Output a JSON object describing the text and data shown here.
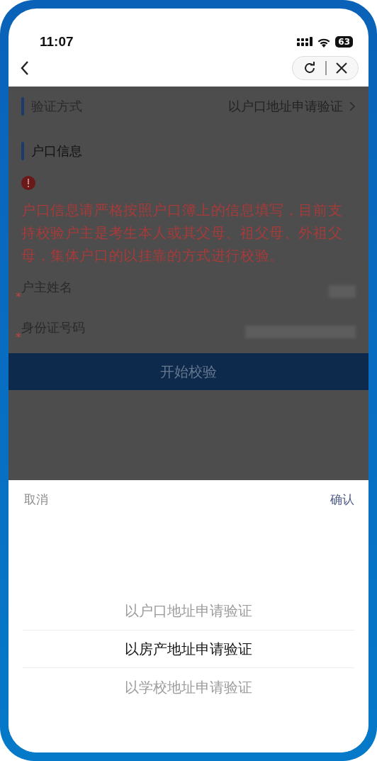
{
  "status_bar": {
    "time": "11:07",
    "battery": "63"
  },
  "form": {
    "method_label": "验证方式",
    "method_value": "以户口地址申请验证",
    "section_title": "户口信息",
    "notice": "户口信息请严格按照户口簿上的信息填写，目前支持校验户主是考生本人或其父母、祖父母、外祖父母，集体户口的以挂靠的方式进行校验。",
    "fields": [
      {
        "mark": "*",
        "label": "户主姓名"
      },
      {
        "mark": "*",
        "label": "身份证号码"
      }
    ],
    "submit": "开始校验"
  },
  "picker": {
    "cancel": "取消",
    "confirm": "确认",
    "options": [
      {
        "label": "以户口地址申请验证",
        "selected": false
      },
      {
        "label": "以房产地址申请验证",
        "selected": true
      },
      {
        "label": "以学校地址申请验证",
        "selected": false
      }
    ]
  }
}
